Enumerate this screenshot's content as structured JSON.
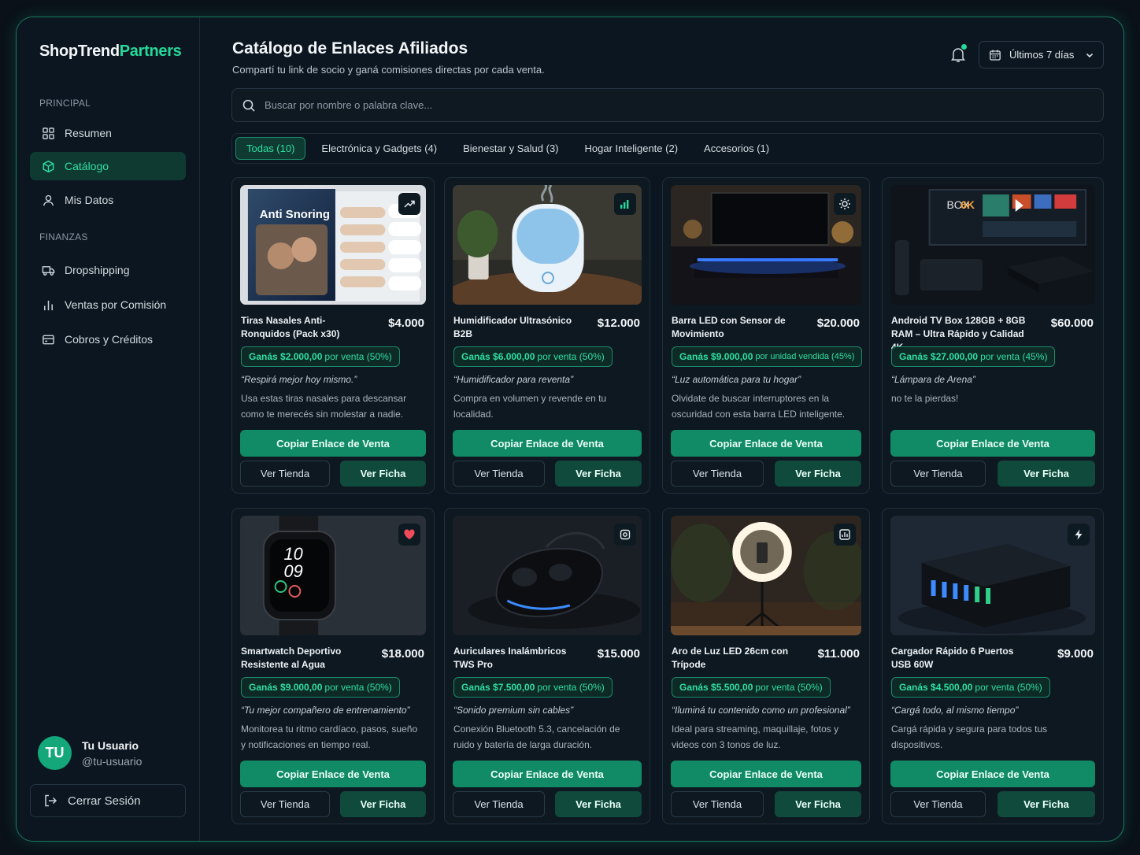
{
  "brand": {
    "name_a": "ShopTrend",
    "name_b": "Partners"
  },
  "sidebar": {
    "section_principal": "PRINCIPAL",
    "section_finanzas": "FINANZAS",
    "items": [
      {
        "label": "Resumen",
        "icon": "grid-icon"
      },
      {
        "label": "Catálogo",
        "icon": "cube-icon",
        "active": true
      },
      {
        "label": "Mis Datos",
        "icon": "user-icon"
      },
      {
        "label": "Dropshipping",
        "icon": "truck-icon"
      },
      {
        "label": "Ventas por Comisión",
        "icon": "bar-chart-icon"
      },
      {
        "label": "Cobros y Créditos",
        "icon": "wallet-icon"
      }
    ],
    "user": {
      "initials": "TU",
      "name": "Tu Usuario",
      "handle": "@tu-usuario"
    },
    "logout": "Cerrar Sesión"
  },
  "header": {
    "title": "Catálogo de Enlaces Afiliados",
    "subtitle": "Compartí tu link de socio y ganá comisiones directas por cada venta.",
    "date_range": "Últimos 7 días"
  },
  "search": {
    "placeholder": "Buscar por nombre o palabra clave..."
  },
  "tabs": [
    {
      "label": "Todas (10)",
      "active": true
    },
    {
      "label": "Electrónica y Gadgets (4)"
    },
    {
      "label": "Bienestar y Salud (3)"
    },
    {
      "label": "Hogar Inteligente (2)"
    },
    {
      "label": "Accesorios (1)"
    }
  ],
  "buttons": {
    "copy": "Copiar Enlace de Venta",
    "store": "Ver Tienda",
    "sheet": "Ver Ficha"
  },
  "colors": {
    "accent": "#26d99a",
    "button": "#118a66",
    "panel": "#0c1620"
  },
  "products": [
    {
      "name": "Tiras Nasales Anti-Ronquidos (Pack x30)",
      "price": "$4.000",
      "earn": "Ganás $2.000,00",
      "earn_note": "por venta (50%)",
      "tagline": "“Respirá mejor hoy mismo.”",
      "desc": "Usa estas tiras nasales para descansar como te merecés sin molestar a nadie.",
      "badge": "trending-up-icon",
      "box_text": "Anti Snoring"
    },
    {
      "name": "Humidificador Ultrasónico B2B",
      "price": "$12.000",
      "earn": "Ganás $6.000,00",
      "earn_note": "por venta (50%)",
      "tagline": "“Humidificador para reventa”",
      "desc": "Compra en volumen y revende en tu localidad.",
      "badge": "chart-icon"
    },
    {
      "name": "Barra LED con Sensor de Movimiento",
      "price": "$20.000",
      "earn": "Ganás $9.000,00",
      "earn_note": "por unidad vendida (45%)",
      "tagline": "“Luz automática para tu hogar”",
      "desc": "Olvidate de buscar interruptores en la oscuridad con esta barra LED inteligente.",
      "badge": "sun-icon"
    },
    {
      "name": "Android TV Box 128GB + 8GB RAM – Ultra Rápido y Calidad 4K",
      "price": "$60.000",
      "earn": "Ganás $27.000,00",
      "earn_note": "por venta (45%)",
      "tagline": "“Lámpara de Arena”",
      "desc": "no te la pierdas!",
      "badge": "none",
      "box_text_a": "BOX",
      "box_text_b": "6K"
    },
    {
      "name": "Smartwatch Deportivo Resistente al Agua",
      "price": "$18.000",
      "earn": "Ganás $9.000,00",
      "earn_note": "por venta (50%)",
      "tagline": "“Tu mejor compañero de entrenamiento”",
      "desc": "Monitorea tu ritmo cardíaco, pasos, sueño y notificaciones en tiempo real.",
      "badge": "heart-icon",
      "watch_h": "10",
      "watch_m": "09"
    },
    {
      "name": "Auriculares Inalámbricos TWS Pro",
      "price": "$15.000",
      "earn": "Ganás $7.500,00",
      "earn_note": "por venta (50%)",
      "tagline": "“Sonido premium sin cables”",
      "desc": "Conexión Bluetooth 5.3, cancelación de ruido y batería de larga duración.",
      "badge": "speaker-icon"
    },
    {
      "name": "Aro de Luz LED 26cm con Trípode",
      "price": "$11.000",
      "earn": "Ganás $5.500,00",
      "earn_note": "por venta (50%)",
      "tagline": "“Iluminá tu contenido como un profesional”",
      "desc": "Ideal para streaming, maquillaje, fotos y videos con 3 tonos de luz.",
      "badge": "analytics-icon"
    },
    {
      "name": "Cargador Rápido 6 Puertos USB 60W",
      "price": "$9.000",
      "earn": "Ganás $4.500,00",
      "earn_note": "por venta (50%)",
      "tagline": "“Cargá todo, al mismo tiempo”",
      "desc": "Cargá rápida y segura para todos tus dispositivos.",
      "badge": "bolt-icon"
    }
  ]
}
